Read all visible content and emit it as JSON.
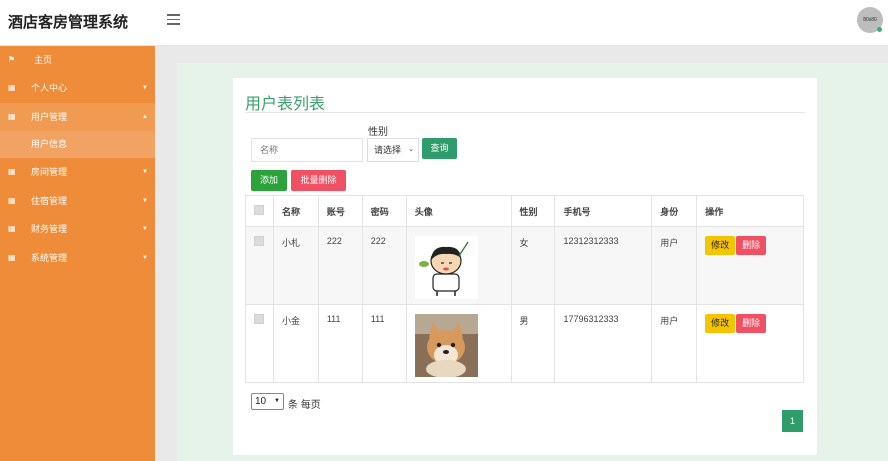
{
  "header": {
    "title": "酒店客房管理系统",
    "avatar_text": "80x80"
  },
  "sidebar": {
    "items": [
      {
        "label": "主页"
      },
      {
        "label": "个人中心"
      },
      {
        "label": "用户管理",
        "sub": "用户信息"
      },
      {
        "label": "房间管理"
      },
      {
        "label": "住宿管理"
      },
      {
        "label": "财务管理"
      },
      {
        "label": "系统管理"
      }
    ]
  },
  "main": {
    "title": "用户表列表",
    "search": {
      "name_placeholder": "名称",
      "gender_label": "性别",
      "gender_value": "请选择",
      "query_label": "查询"
    },
    "actions": {
      "add_label": "添加",
      "batch_delete_label": "批量删除"
    },
    "table": {
      "columns": [
        "名称",
        "账号",
        "密码",
        "头像",
        "性别",
        "手机号",
        "身份",
        "操作"
      ],
      "rows": [
        {
          "name": "小札",
          "account": "222",
          "password": "222",
          "avatar": "cartoon-boy-avatar",
          "gender": "女",
          "phone": "12312312333",
          "role": "用户",
          "edit": "修改",
          "delete": "删除"
        },
        {
          "name": "小金",
          "account": "111",
          "password": "111",
          "avatar": "shiba-dog-avatar",
          "gender": "男",
          "phone": "17796312333",
          "role": "用户",
          "edit": "修改",
          "delete": "删除"
        }
      ]
    },
    "pagination": {
      "page_size": "10",
      "page_size_suffix": "条 每页",
      "current_page": "1"
    }
  },
  "colors": {
    "sidebar": "#ef8c3a",
    "accent_green": "#2e9c6b",
    "add_green": "#2ca23b",
    "danger": "#f05063",
    "warning": "#f5c400"
  }
}
